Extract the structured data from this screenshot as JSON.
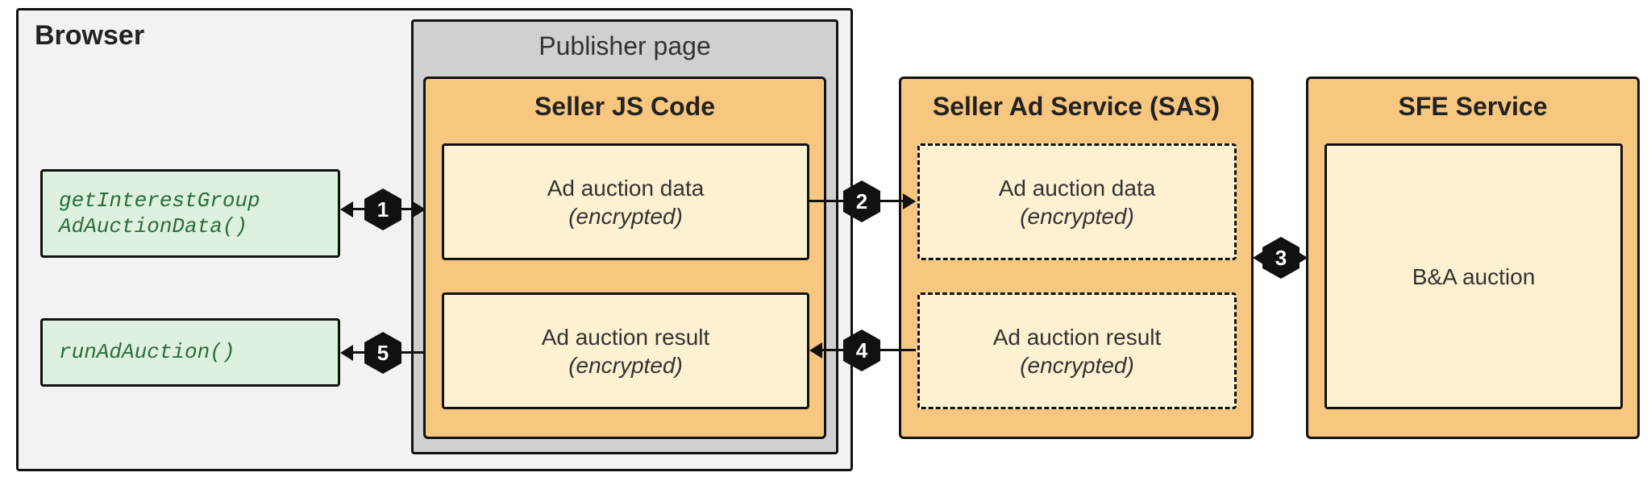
{
  "browser": {
    "title": "Browser",
    "publisher_title": "Publisher page",
    "api1_line1": "getInterestGroup",
    "api1_line2": "AdAuctionData()",
    "api2": "runAdAuction()"
  },
  "seller_js": {
    "title": "Seller JS Code",
    "data_label": "Ad auction data",
    "data_sub": "(encrypted)",
    "result_label": "Ad auction result",
    "result_sub": "(encrypted)"
  },
  "sas": {
    "title": "Seller Ad Service (SAS)",
    "data_label": "Ad auction data",
    "data_sub": "(encrypted)",
    "result_label": "Ad auction result",
    "result_sub": "(encrypted)"
  },
  "sfe": {
    "title": "SFE Service",
    "content": "B&A auction"
  },
  "steps": {
    "s1": "1",
    "s2": "2",
    "s3": "3",
    "s4": "4",
    "s5": "5"
  }
}
